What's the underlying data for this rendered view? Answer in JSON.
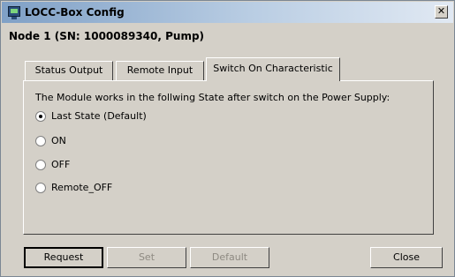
{
  "window": {
    "title": "LOCC-Box Config",
    "close_glyph": "✕"
  },
  "node_label": "Node 1 (SN: 1000089340, Pump)",
  "tabs": [
    {
      "label": "Status Output",
      "active": false
    },
    {
      "label": "Remote Input",
      "active": false
    },
    {
      "label": "Switch On Characteristic",
      "active": true
    }
  ],
  "panel": {
    "description": "The Module works in the follwing State after switch on the Power Supply:",
    "options": [
      {
        "label": "Last State (Default)",
        "checked": true
      },
      {
        "label": "ON",
        "checked": false
      },
      {
        "label": "OFF",
        "checked": false
      },
      {
        "label": "Remote_OFF",
        "checked": false
      }
    ]
  },
  "buttons": {
    "request": "Request",
    "set": "Set",
    "default": "Default",
    "close": "Close"
  },
  "icons": {
    "app": "monitor-icon",
    "close": "close-icon",
    "radio": "radio-icon"
  }
}
